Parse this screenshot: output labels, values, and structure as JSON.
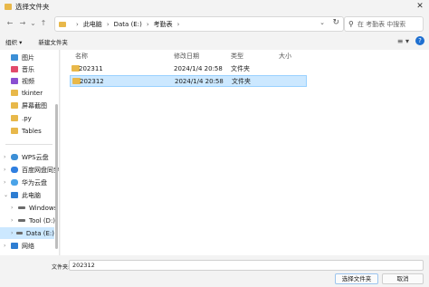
{
  "window": {
    "title": "选择文件夹",
    "close_glyph": "✕"
  },
  "address": {
    "crumbs": [
      "此电脑",
      "Data (E:)",
      "考勤表"
    ],
    "separator": "›",
    "dropdown_glyph": "⌄",
    "refresh_glyph": "↻"
  },
  "nav_buttons": {
    "back": "←",
    "forward": "→",
    "dropdown": "⌄",
    "up": "↑"
  },
  "search": {
    "placeholder": "在 考勤表 中搜索",
    "icon_glyph": "⚲"
  },
  "toolbar": {
    "organize": "组织 ▾",
    "new_folder": "新建文件夹",
    "view_glyph": "≡ ▾",
    "help_glyph": "?"
  },
  "sidebar": {
    "quick_access": [
      {
        "label": "图片",
        "icon": "pictures-icon",
        "pinned": true
      },
      {
        "label": "音乐",
        "icon": "music-icon",
        "pinned": true
      },
      {
        "label": "视频",
        "icon": "video-icon",
        "pinned": true
      },
      {
        "label": "tkinter",
        "icon": "folder-icon",
        "pinned": false
      },
      {
        "label": "屏幕截图",
        "icon": "folder-icon",
        "pinned": false
      },
      {
        "label": ".py",
        "icon": "folder-icon",
        "pinned": false
      },
      {
        "label": "Tables",
        "icon": "folder-icon",
        "pinned": false
      }
    ],
    "tree": [
      {
        "label": "WPS云盘",
        "expander": "›",
        "icon": "cloud-icon",
        "indent": 0
      },
      {
        "label": "百度网盘同步",
        "expander": "›",
        "icon": "cloud-icon",
        "indent": 0
      },
      {
        "label": "华为云盘",
        "expander": "›",
        "icon": "cloud-icon",
        "indent": 0
      },
      {
        "label": "此电脑",
        "expander": "⌄",
        "icon": "computer-icon",
        "indent": 0
      },
      {
        "label": "Windows",
        "expander": "›",
        "icon": "drive-icon",
        "indent": 1
      },
      {
        "label": "Tool (D:)",
        "expander": "›",
        "icon": "drive-icon",
        "indent": 1
      },
      {
        "label": "Data (E:)",
        "expander": "›",
        "icon": "drive-icon",
        "indent": 1,
        "active": true
      },
      {
        "label": "网络",
        "expander": "›",
        "icon": "network-icon",
        "indent": 0
      }
    ],
    "pin_glyph": "⊿"
  },
  "columns": {
    "name": "名称",
    "modified": "修改日期",
    "type": "类型",
    "size": "大小"
  },
  "rows": [
    {
      "name": "202311",
      "modified": "2024/1/4 20:58",
      "type": "文件夹",
      "size": ""
    },
    {
      "name": "202312",
      "modified": "2024/1/4 20:58",
      "type": "文件夹",
      "size": ""
    }
  ],
  "bottom": {
    "filename_label": "文件夹:",
    "filename_value": "202312",
    "select_button": "选择文件夹",
    "cancel_button": "取消"
  },
  "colors": {
    "accent": "#1e6fd0",
    "selection": "#cce8ff",
    "folder": "#e8b84a"
  }
}
